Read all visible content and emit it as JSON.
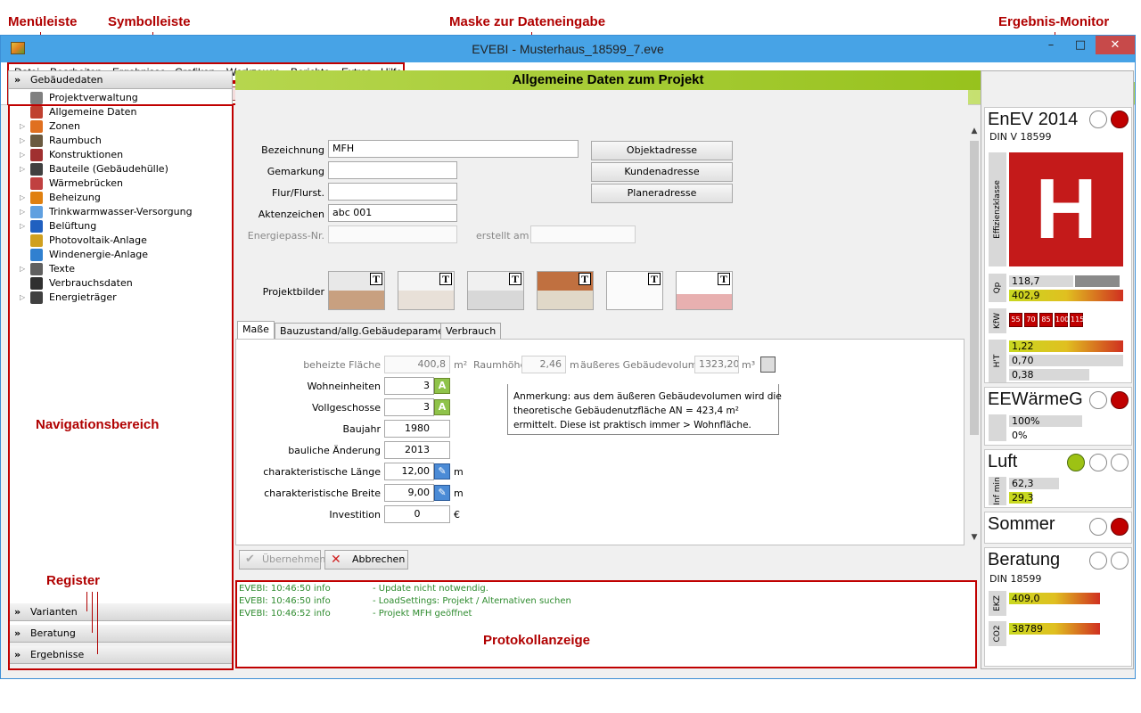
{
  "annotations": {
    "menubar": "Menüleiste",
    "toolbar": "Symbolleiste",
    "mask": "Maske zur Dateneingabe",
    "monitor": "Ergebnis-Monitor",
    "nav": "Navigationsbereich",
    "register": "Register",
    "log": "Protokollanzeige"
  },
  "window": {
    "title": "EVEBI - Musterhaus_18599_7.eve"
  },
  "menu": [
    "Datei",
    "Bearbeiten",
    "Ergebnisse",
    "Grafiken",
    "Werkzeuge",
    "Berichte",
    "Extras",
    "Hilfe"
  ],
  "nav": {
    "header": "Gebäudedaten",
    "items": [
      {
        "label": "Projektverwaltung",
        "icon": "project-management-icon",
        "expandable": false
      },
      {
        "label": "Allgemeine Daten",
        "icon": "house-data-icon",
        "expandable": false
      },
      {
        "label": "Zonen",
        "icon": "zones-icon",
        "expandable": true
      },
      {
        "label": "Raumbuch",
        "icon": "roombook-icon",
        "expandable": true
      },
      {
        "label": "Konstruktionen",
        "icon": "constructions-icon",
        "expandable": true
      },
      {
        "label": "Bauteile (Gebäudehülle)",
        "icon": "building-parts-icon",
        "expandable": true
      },
      {
        "label": "Wärmebrücken",
        "icon": "thermal-bridge-icon",
        "expandable": false
      },
      {
        "label": "Beheizung",
        "icon": "heating-icon",
        "expandable": true
      },
      {
        "label": "Trinkwarmwasser-Versorgung",
        "icon": "hot-water-icon",
        "expandable": true
      },
      {
        "label": "Belüftung",
        "icon": "ventilation-icon",
        "expandable": true
      },
      {
        "label": "Photovoltaik-Anlage",
        "icon": "photovoltaic-icon",
        "expandable": false
      },
      {
        "label": "Windenergie-Anlage",
        "icon": "wind-energy-icon",
        "expandable": false
      },
      {
        "label": "Texte",
        "icon": "texts-icon",
        "expandable": true
      },
      {
        "label": "Verbrauchsdaten",
        "icon": "consumption-icon",
        "expandable": false
      },
      {
        "label": "Energieträger",
        "icon": "energy-carrier-icon",
        "expandable": true
      }
    ],
    "registers": [
      "Varianten",
      "Beratung",
      "Ergebnisse"
    ]
  },
  "main": {
    "title": "Allgemeine Daten zum Projekt",
    "fields": {
      "bezeichnung": {
        "label": "Bezeichnung",
        "value": "MFH"
      },
      "gemarkung": {
        "label": "Gemarkung",
        "value": ""
      },
      "flur": {
        "label": "Flur/Flurst.",
        "value": ""
      },
      "aktenzeichen": {
        "label": "Aktenzeichen",
        "value": "abc 001"
      },
      "energiepass": {
        "label": "Energiepass-Nr.",
        "value": ""
      },
      "erstellt": {
        "label": "erstellt am",
        "value": ""
      }
    },
    "address_buttons": [
      "Objektadresse",
      "Kundenadresse",
      "Planeradresse"
    ],
    "projektbilder_label": "Projektbilder",
    "tabs": [
      "Maße",
      "Bauzustand/allg.Gebäudeparameter",
      "Verbrauch"
    ],
    "masse": {
      "beheizte_flaeche": {
        "label": "beheizte Fläche",
        "value": "400,8",
        "unit": "m²"
      },
      "raumhoehe": {
        "label": "Raumhöhe",
        "value": "2,46",
        "unit": "m"
      },
      "volumen": {
        "label": "äußeres Gebäudevolumen",
        "value": "1323,20",
        "unit": "m³"
      },
      "wohneinheiten": {
        "label": "Wohneinheiten",
        "value": "3"
      },
      "vollgeschosse": {
        "label": "Vollgeschosse",
        "value": "3"
      },
      "baujahr": {
        "label": "Baujahr",
        "value": "1980"
      },
      "aenderung": {
        "label": "bauliche Änderung",
        "value": "2013"
      },
      "laenge": {
        "label": "charakteristische Länge",
        "value": "12,00",
        "unit": "m"
      },
      "breite": {
        "label": "charakteristische Breite",
        "value": "9,00",
        "unit": "m"
      },
      "investition": {
        "label": "Investition",
        "value": "0",
        "unit": "€"
      },
      "note_line1": "Anmerkung: aus dem äußeren Gebäudevolumen wird die",
      "note_line2": "theoretische Gebäudenutzfläche AN =   423,4 m²",
      "note_line3": "ermittelt. Diese ist praktisch immer > Wohnfläche."
    },
    "buttons": {
      "apply": "Übernehmen",
      "cancel": "Abbrechen"
    }
  },
  "log": [
    {
      "time": "EVEBI: 10:46:50 info",
      "msg": "- Update nicht notwendig."
    },
    {
      "time": "EVEBI: 10:46:50 info",
      "msg": "- LoadSettings: Projekt / Alternativen suchen"
    },
    {
      "time": "EVEBI: 10:46:52 info",
      "msg": "- Projekt MFH geöffnet"
    }
  ],
  "monitor": {
    "enev": {
      "title": "EnEV 2014",
      "subtitle": "DIN V 18599",
      "class_label": "Effizienzklasse",
      "class": "H",
      "qp_label": "Qp",
      "qp_values": [
        "118,7",
        "402,9"
      ],
      "kw_label": "KfW",
      "kw_levels": [
        "55",
        "70",
        "85",
        "100",
        "115"
      ],
      "ht_label": "H'T",
      "ht_values": [
        "1,22",
        "0,70",
        "0,38"
      ]
    },
    "eewaermeg": {
      "title": "EEWärmeG",
      "values": [
        "100%",
        "0%"
      ]
    },
    "luft": {
      "title": "Luft",
      "label": "Inf min",
      "values": [
        "62,3",
        "29,3"
      ]
    },
    "sommer": {
      "title": "Sommer"
    },
    "beratung": {
      "title": "Beratung",
      "subtitle": "DIN 18599",
      "ekz_label": "EKZ",
      "ekz_value": "409,0",
      "co2_label": "CO2",
      "co2_value": "38789"
    }
  },
  "colors": {
    "accent_green": "#9dc214",
    "alert_red": "#c00000",
    "log_green": "#2e8b2e",
    "title_bar": "#47a3e6"
  }
}
